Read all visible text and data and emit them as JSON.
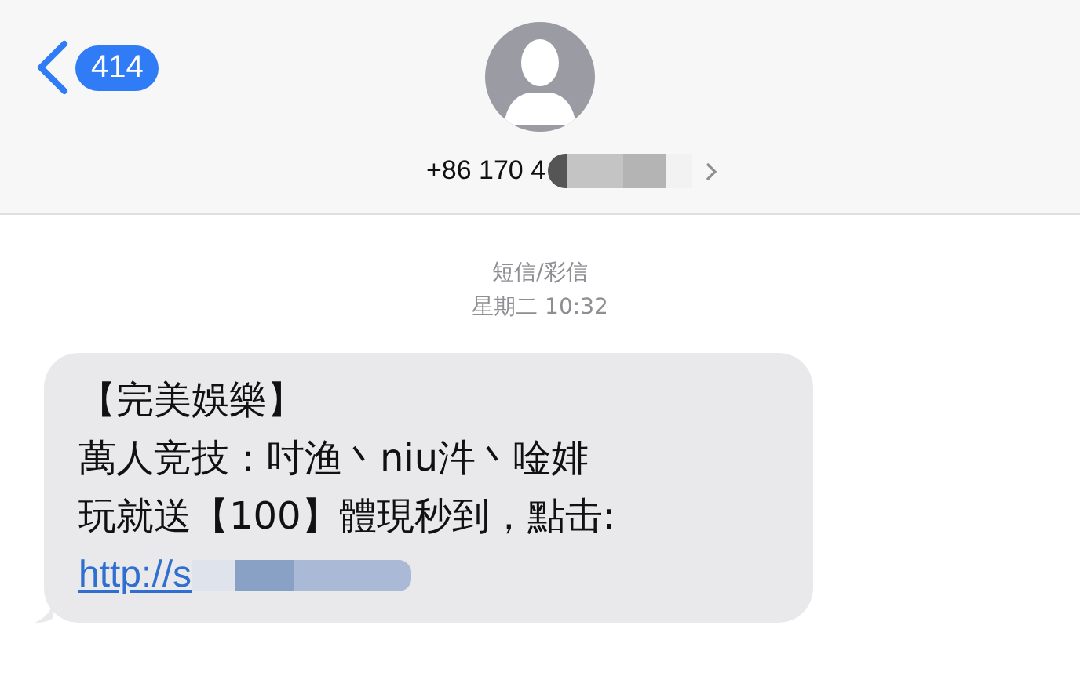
{
  "header": {
    "back_badge": "414",
    "contact": {
      "phone_visible": "+86 170 4",
      "redacted": true
    }
  },
  "conversation": {
    "service": "短信/彩信",
    "timestamp": "星期二 10:32",
    "messages": [
      {
        "kind": "incoming",
        "lines": [
          "【完美娛樂】",
          "萬人竞技：吋渔丶niu汼丶唫婔",
          "玩就送【100】體現秒到，點击:"
        ],
        "link": "http://s",
        "link_redacted": true
      }
    ]
  }
}
